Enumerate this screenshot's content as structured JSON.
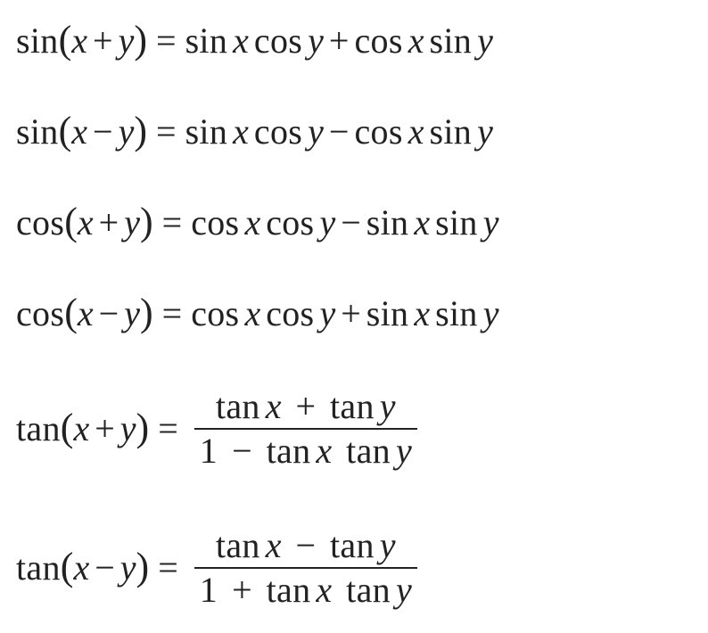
{
  "equations": [
    {
      "lhs": {
        "fn": "sin",
        "argL": "x",
        "argOp": "+",
        "argR": "y"
      },
      "rhs_simple": {
        "t1f": "sin",
        "t1v": "x",
        "t2f": "cos",
        "t2v": "y",
        "op": "+",
        "t3f": "cos",
        "t3v": "x",
        "t4f": "sin",
        "t4v": "y"
      }
    },
    {
      "lhs": {
        "fn": "sin",
        "argL": "x",
        "argOp": "−",
        "argR": "y"
      },
      "rhs_simple": {
        "t1f": "sin",
        "t1v": "x",
        "t2f": "cos",
        "t2v": "y",
        "op": "−",
        "t3f": "cos",
        "t3v": "x",
        "t4f": "sin",
        "t4v": "y"
      }
    },
    {
      "lhs": {
        "fn": "cos",
        "argL": "x",
        "argOp": "+",
        "argR": "y"
      },
      "rhs_simple": {
        "t1f": "cos",
        "t1v": "x",
        "t2f": "cos",
        "t2v": "y",
        "op": "−",
        "t3f": "sin",
        "t3v": "x",
        "t4f": "sin",
        "t4v": "y"
      }
    },
    {
      "lhs": {
        "fn": "cos",
        "argL": "x",
        "argOp": "−",
        "argR": "y"
      },
      "rhs_simple": {
        "t1f": "cos",
        "t1v": "x",
        "t2f": "cos",
        "t2v": "y",
        "op": "+",
        "t3f": "sin",
        "t3v": "x",
        "t4f": "sin",
        "t4v": "y"
      }
    },
    {
      "lhs": {
        "fn": "tan",
        "argL": "x",
        "argOp": "+",
        "argR": "y"
      },
      "rhs_frac": {
        "num": {
          "af": "tan",
          "av": "x",
          "op": "+",
          "bf": "tan",
          "bv": "y"
        },
        "den": {
          "one": "1",
          "op": "−",
          "af": "tan",
          "av": "x",
          "bf": "tan",
          "bv": "y"
        }
      }
    },
    {
      "lhs": {
        "fn": "tan",
        "argL": "x",
        "argOp": "−",
        "argR": "y"
      },
      "rhs_frac": {
        "num": {
          "af": "tan",
          "av": "x",
          "op": "−",
          "bf": "tan",
          "bv": "y"
        },
        "den": {
          "one": "1",
          "op": "+",
          "af": "tan",
          "av": "x",
          "bf": "tan",
          "bv": "y"
        }
      }
    }
  ],
  "sym": {
    "eq": "="
  }
}
